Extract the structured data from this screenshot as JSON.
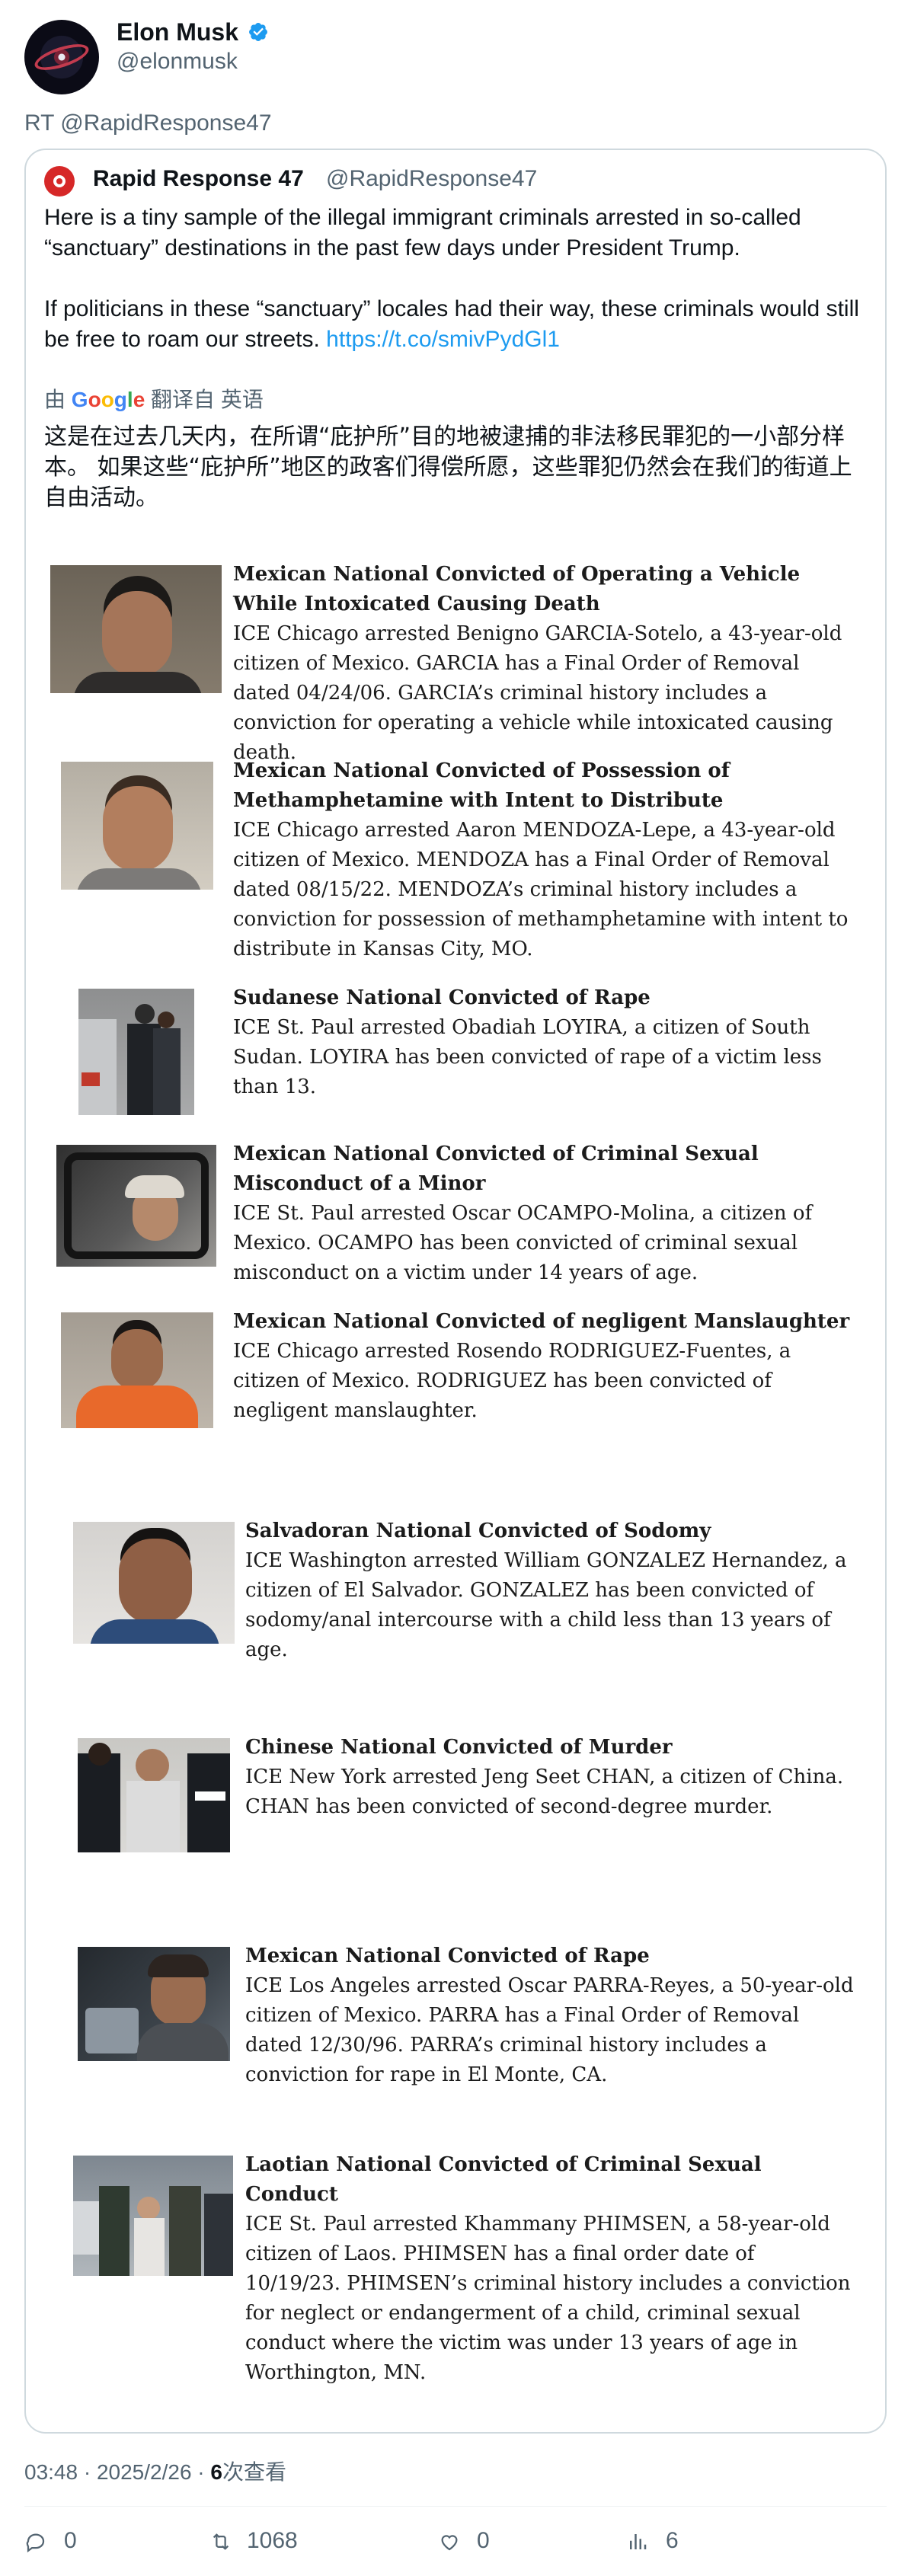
{
  "author": {
    "name": "Elon Musk",
    "handle": "@elonmusk"
  },
  "retweet_label": "RT @RapidResponse47",
  "quoted": {
    "name": "Rapid Response 47",
    "handle": "@RapidResponse47",
    "paragraph1": "Here is a tiny sample of the illegal immigrant criminals arrested in so-called “sanctuary” destinations in the past few days under President Trump.",
    "paragraph2": "If politicians in these “sanctuary” locales had their way, these criminals would still be free to roam our streets. ",
    "link": "https://t.co/smivPydGl1",
    "translate": {
      "prefix": "由",
      "brand": "Google",
      "suffix": "翻译自 英语"
    },
    "translated_text": "这是在过去几天内，在所谓“庇护所”目的地被逮捕的非法移民罪犯的一小部分样本。 如果这些“庇护所”地区的政客们得偿所愿，这些罪犯仍然会在我们的街道上自由活动。"
  },
  "entries": [
    {
      "title": "Mexican National Convicted of Operating a Vehicle While Intoxicated Causing Death",
      "body": "ICE Chicago arrested Benigno GARCIA-Sotelo, a 43-year-old citizen of Mexico. GARCIA has a Final Order of Removal dated 04/24/06.  GARCIA’s criminal history includes a conviction for operating a vehicle while intoxicated causing death.",
      "photo": "mugshot-man-beige-wall"
    },
    {
      "title": "Mexican National Convicted of Possession of Methamphetamine with Intent to Distribute",
      "body": "ICE Chicago arrested Aaron MENDOZA-Lepe, a 43-year-old citizen of Mexico. MENDOZA has a Final Order of Removal dated 08/15/22. MENDOZA’s criminal history includes a conviction for possession of methamphetamine with intent to distribute in Kansas City, MO.",
      "photo": "mugshot-man-indoor"
    },
    {
      "title": "Sudanese National Convicted of Rape",
      "body": "ICE St. Paul arrested Obadiah LOYIRA, a citizen of South Sudan. LOYIRA has been convicted of rape of a victim less than 13.",
      "photo": "arrest-near-vehicle"
    },
    {
      "title": "Mexican National Convicted of Criminal Sexual Misconduct of a Minor",
      "body": "ICE St. Paul arrested Oscar OCAMPO-Molina, a citizen of Mexico. OCAMPO has been convicted of criminal sexual misconduct on a victim under 14 years of age.",
      "photo": "man-in-car"
    },
    {
      "title": "Mexican National Convicted of negligent Manslaughter",
      "body": "ICE Chicago arrested Rosendo RODRIGUEZ-Fuentes, a citizen of Mexico. RODRIGUEZ has been convicted of negligent manslaughter.",
      "photo": "man-orange-jumpsuit"
    },
    {
      "title": "Salvadoran National Convicted of Sodomy",
      "body": "ICE Washington arrested William GONZALEZ Hernandez, a citizen of El Salvador. GONZALEZ has been convicted of sodomy/anal intercourse with a child less than 13 years of age.",
      "photo": "mugshot-man-blue"
    },
    {
      "title": "Chinese National Convicted of Murder",
      "body": "ICE New York arrested Jeng Seet CHAN, a citizen of China. CHAN has been convicted of second-degree murder.",
      "photo": "escort-by-officers"
    },
    {
      "title": "Mexican National Convicted of Rape",
      "body": "ICE Los Angeles arrested Oscar PARRA-Reyes, a 50-year-old citizen of Mexico. PARRA has a Final Order of Removal dated 12/30/96. PARRA’s criminal history includes a conviction for rape in El Monte, CA.",
      "photo": "man-outdoor-night"
    },
    {
      "title": "Laotian National Convicted of Criminal Sexual Conduct",
      "body": "ICE St. Paul arrested Khammany PHIMSEN, a 58-year-old citizen of Laos. PHIMSEN has a final order date of 10/19/23. PHIMSEN’s criminal history includes a conviction for neglect or endangerment of a child, criminal sexual conduct where the victim was under 13 years of age in Worthington, MN.",
      "photo": "officers-with-detainee"
    }
  ],
  "meta": {
    "time": "03:48 · 2025/2/26 · ",
    "views_count": "6",
    "views_label": "次查看"
  },
  "actions": {
    "replies": "0",
    "retweets": "1068",
    "likes": "0",
    "views": "6"
  },
  "colors": {
    "link": "#1d9bf0",
    "verified": "#1d9bf0",
    "secondary_text": "#536471",
    "border": "#cfd9de"
  }
}
